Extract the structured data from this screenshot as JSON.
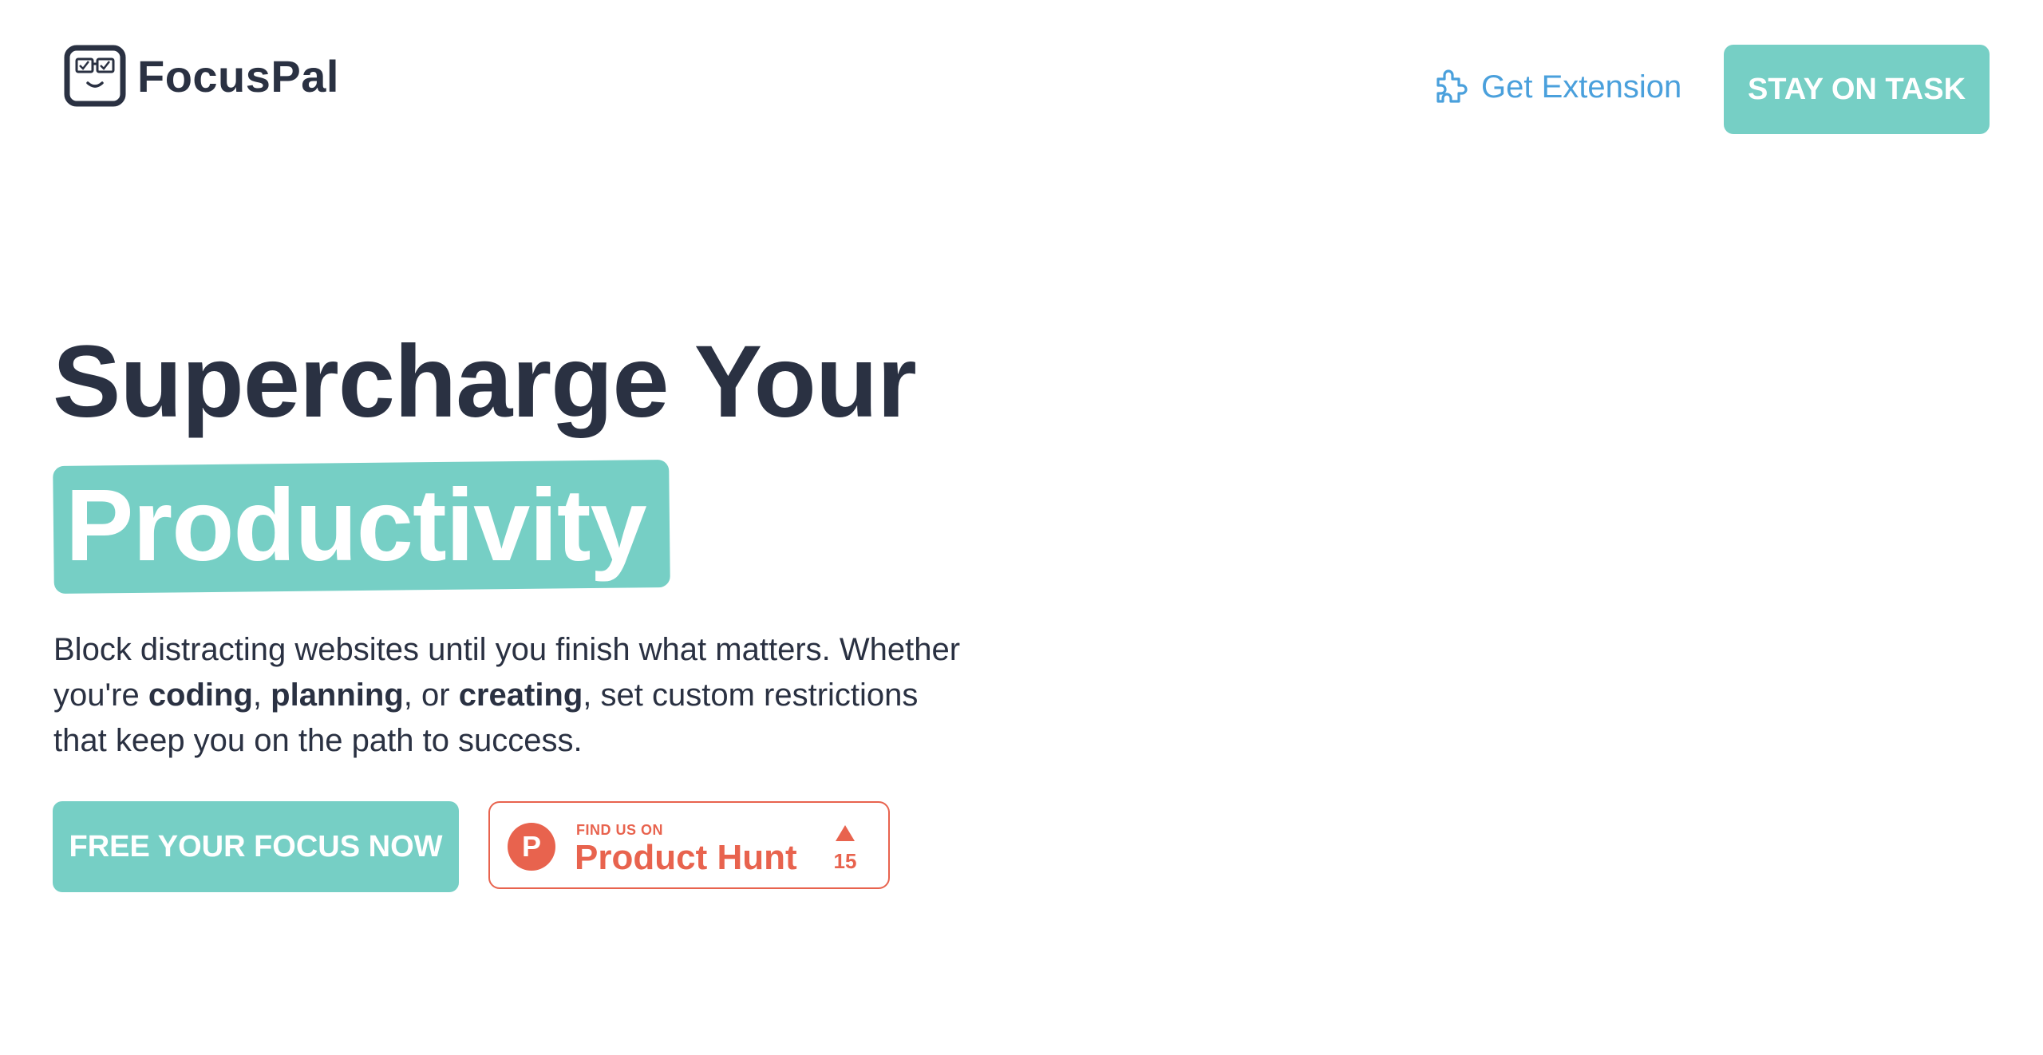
{
  "header": {
    "brand": "FocusPal",
    "logo_icon": "robot-face-icon",
    "get_extension_label": "Get Extension",
    "extension_icon": "puzzle-piece-icon",
    "stay_on_task_label": "STAY ON TASK"
  },
  "hero": {
    "title_line1": "Supercharge Your",
    "title_highlight": "Productivity",
    "description": {
      "part1": "Block distracting websites until you finish what matters. Whether you're ",
      "bold1": "coding",
      "sep1": ", ",
      "bold2": "planning",
      "sep2": ", or ",
      "bold3": "creating",
      "part2": ", set custom restrictions that keep you on the path to success."
    },
    "cta_label": "FREE YOUR FOCUS NOW",
    "product_hunt": {
      "find_us": "FIND US ON",
      "name": "Product Hunt",
      "logo_letter": "P",
      "upvotes": "15"
    }
  },
  "colors": {
    "accent": "#76cfc5",
    "text_dark": "#2a3142",
    "link_blue": "#4aa0dc",
    "product_hunt": "#e8634e"
  }
}
